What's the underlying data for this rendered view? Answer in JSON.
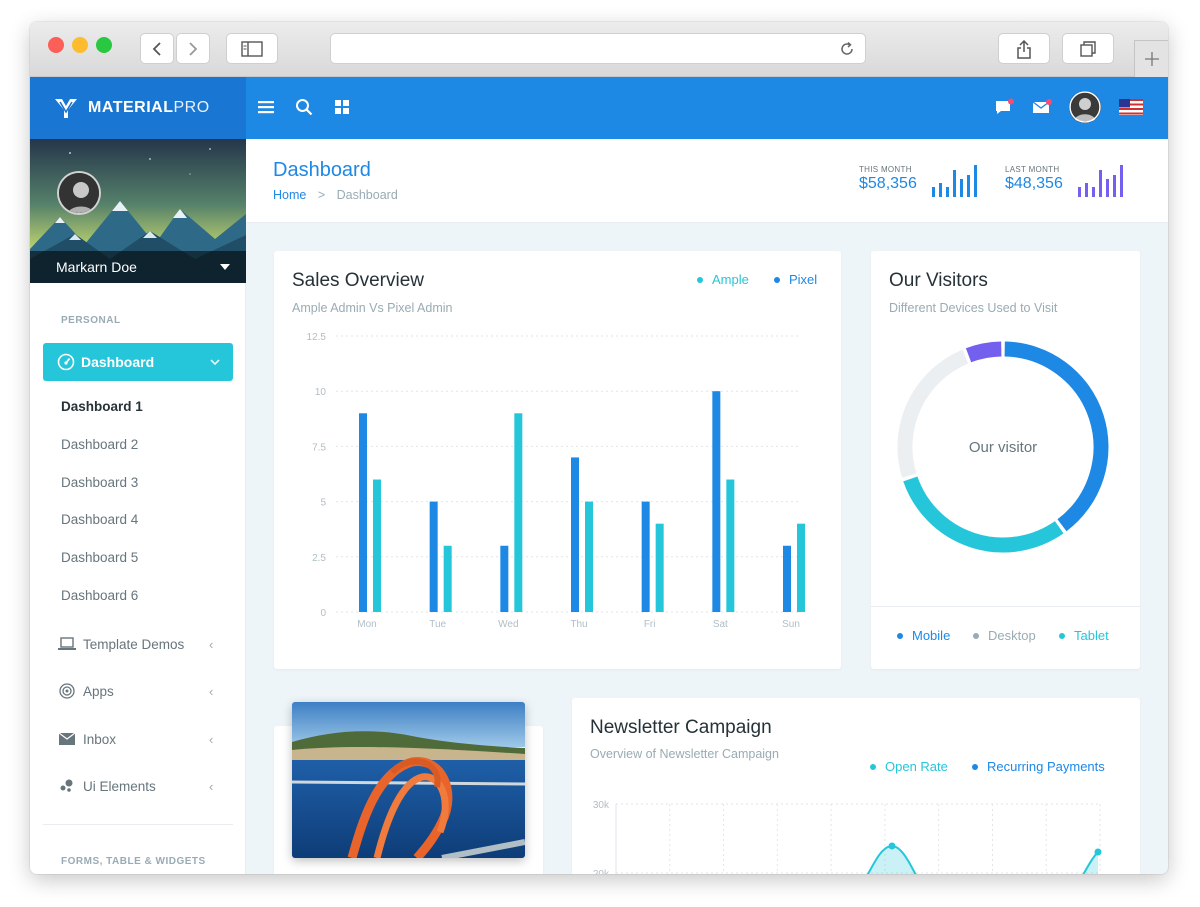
{
  "brand": {
    "bold": "MATERIAL",
    "thin": "PRO"
  },
  "topbar": {
    "icons": [
      "menu-icon",
      "search-icon",
      "apps-grid-icon",
      "message-icon",
      "mail-icon",
      "avatar",
      "us-flag-icon"
    ]
  },
  "profile": {
    "name": "Markarn Doe"
  },
  "sidebar": {
    "personal_caption": "PERSONAL",
    "active": "Dashboard",
    "sub_items": [
      "Dashboard 1",
      "Dashboard 2",
      "Dashboard 3",
      "Dashboard 4",
      "Dashboard 5",
      "Dashboard 6"
    ],
    "items": [
      {
        "label": "Template Demos",
        "icon": "laptop-icon"
      },
      {
        "label": "Apps",
        "icon": "target-icon"
      },
      {
        "label": "Inbox",
        "icon": "mail-icon"
      },
      {
        "label": "Ui Elements",
        "icon": "bubbles-icon"
      }
    ],
    "forms_caption": "FORMS, TABLE & WIDGETS"
  },
  "page": {
    "title": "Dashboard",
    "breadcrumb_home": "Home",
    "breadcrumb_current": "Dashboard"
  },
  "stats": {
    "this_month": {
      "label": "THIS MONTH",
      "value": "$58,356",
      "bars": [
        0.3,
        0.45,
        0.3,
        0.85,
        0.55,
        0.7,
        1.0
      ],
      "color": "#1e88e5"
    },
    "last_month": {
      "label": "LAST MONTH",
      "value": "$48,356",
      "bars": [
        0.3,
        0.45,
        0.3,
        0.85,
        0.55,
        0.7,
        1.0
      ],
      "color": "#7460ee"
    }
  },
  "sales": {
    "title": "Sales Overview",
    "subtitle": "Ample Admin Vs Pixel Admin",
    "legend": [
      {
        "label": "Ample",
        "color": "#26c6da"
      },
      {
        "label": "Pixel",
        "color": "#1e88e5"
      }
    ]
  },
  "visitors": {
    "title": "Our Visitors",
    "subtitle": "Different Devices Used to Visit",
    "center_label": "Our visitor",
    "legend": [
      {
        "label": "Mobile",
        "color": "#1e88e5"
      },
      {
        "label": "Desktop",
        "color": "#99abb4"
      },
      {
        "label": "Tablet",
        "color": "#26c6da"
      }
    ]
  },
  "newsletter": {
    "title": "Newsletter Campaign",
    "subtitle": "Overview of Newsletter Campaign",
    "legend": [
      {
        "label": "Open Rate",
        "color": "#26c6da"
      },
      {
        "label": "Recurring Payments",
        "color": "#1e88e5"
      }
    ]
  },
  "chart_data": [
    {
      "type": "bar",
      "categories": [
        "Mon",
        "Tue",
        "Wed",
        "Thu",
        "Fri",
        "Sat",
        "Sun"
      ],
      "series": [
        {
          "name": "Pixel",
          "color": "#1e88e5",
          "values": [
            9,
            5,
            3,
            7,
            5,
            10,
            3
          ]
        },
        {
          "name": "Ample",
          "color": "#26c6da",
          "values": [
            6,
            3,
            9,
            5,
            4,
            6,
            4
          ]
        }
      ],
      "yticks": [
        "0",
        "2.5",
        "5",
        "7.5",
        "10",
        "12.5"
      ],
      "ylim": [
        0,
        12.5
      ],
      "grid": true
    },
    {
      "type": "pie",
      "donut": true,
      "series": [
        {
          "name": "Mobile",
          "color": "#1e88e5",
          "value": 40
        },
        {
          "name": "Tablet",
          "color": "#26c6da",
          "value": 30
        },
        {
          "name": "Desktop",
          "color": "#eceff1",
          "value": 24
        },
        {
          "name": "Other",
          "color": "#7460ee",
          "value": 6
        }
      ]
    },
    {
      "type": "area",
      "yticks": [
        "20k",
        "30k"
      ],
      "series": [
        {
          "name": "Open Rate",
          "color": "#26c6da"
        }
      ],
      "grid": true
    }
  ]
}
